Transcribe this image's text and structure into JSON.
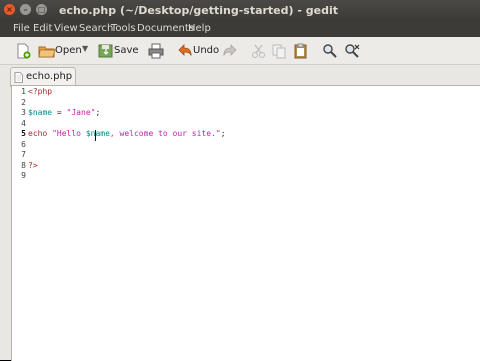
{
  "window": {
    "title": "echo.php (~/Desktop/getting-started) - gedit",
    "controls": {
      "close": "×",
      "minimize": "–",
      "maximize": "□"
    }
  },
  "menu": [
    "File",
    "Edit",
    "View",
    "Search",
    "Tools",
    "Documents",
    "Help"
  ],
  "toolbar": {
    "open_label": "Open",
    "save_label": "Save",
    "undo_label": "Undo"
  },
  "tab": {
    "label": "echo.php"
  },
  "editor": {
    "line_numbers": [
      "1",
      "2",
      "3",
      "4",
      "5",
      "6",
      "7",
      "8",
      "9"
    ],
    "current_line": "5",
    "lines": {
      "l1": "<?php",
      "l3_var": "$name",
      "l3_eq": " = ",
      "l3_str": "\"Jane\"",
      "l3_end": ";",
      "l5_kw": "echo",
      "l5_sp": " ",
      "l5_str1": "\"Hello ",
      "l5_var": "$name",
      "l5_str2": ", welcome to our site.\"",
      "l5_end": ";",
      "l8": "?>"
    }
  },
  "colors": {
    "php_tag": "#a52a2a",
    "variable": "#008b8b",
    "string": "#c41ea8",
    "titlebar": "#3c3b37",
    "close_button": "#e85a2a"
  }
}
